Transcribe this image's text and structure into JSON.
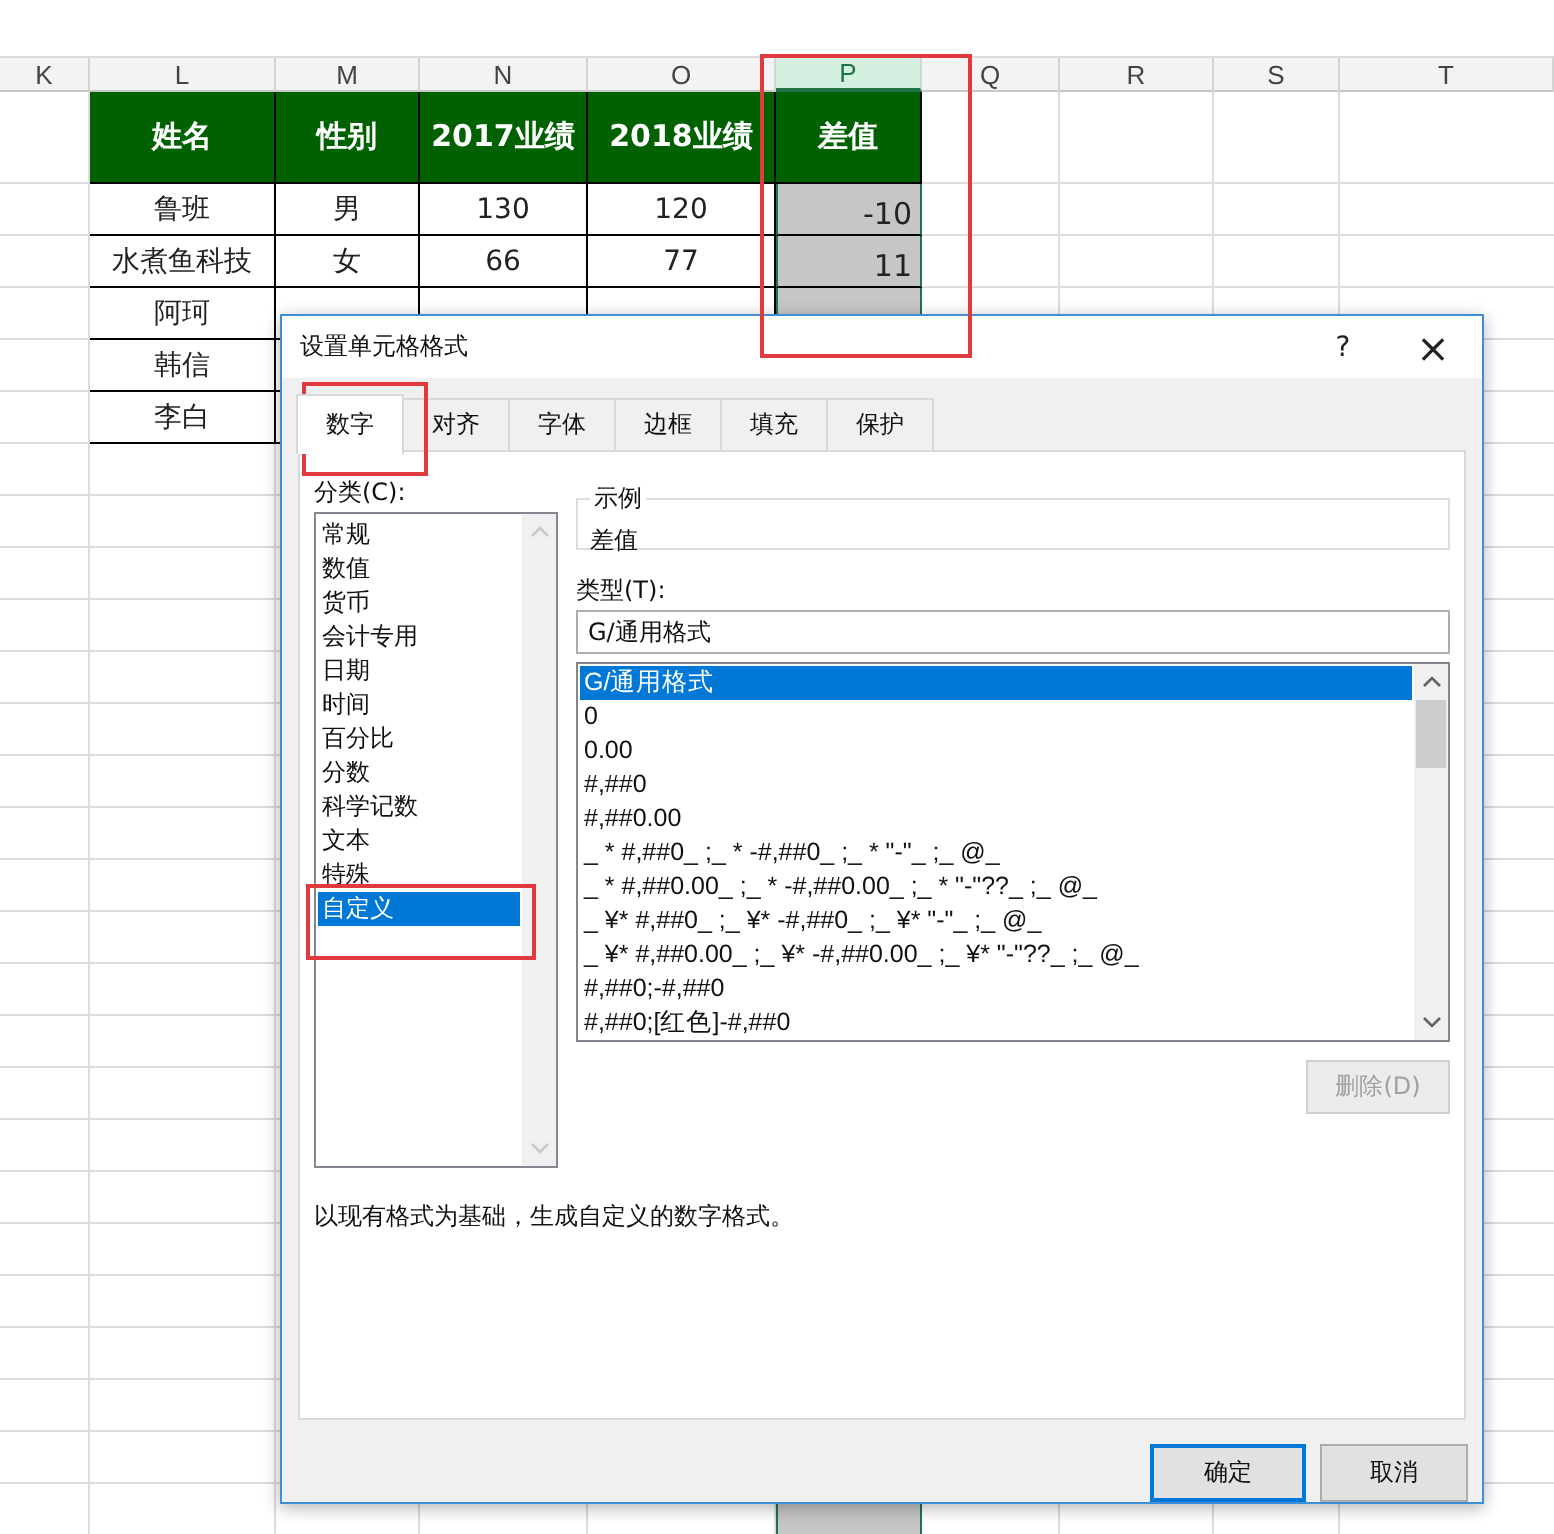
{
  "sheet": {
    "columns": [
      {
        "label": "K",
        "selected": false
      },
      {
        "label": "L",
        "selected": false
      },
      {
        "label": "M",
        "selected": false
      },
      {
        "label": "N",
        "selected": false
      },
      {
        "label": "O",
        "selected": false
      },
      {
        "label": "P",
        "selected": true
      },
      {
        "label": "Q",
        "selected": false
      },
      {
        "label": "R",
        "selected": false
      },
      {
        "label": "S",
        "selected": false
      },
      {
        "label": "T",
        "selected": false
      }
    ],
    "table": {
      "header": [
        "姓名",
        "性别",
        "2017业绩",
        "2018业绩",
        "差值"
      ],
      "rows": [
        [
          "鲁班",
          "男",
          "130",
          "120",
          "-10"
        ],
        [
          "水煮鱼科技",
          "女",
          "66",
          "77",
          "11"
        ],
        [
          "阿珂"
        ],
        [
          "韩信"
        ],
        [
          "李白"
        ]
      ]
    }
  },
  "dialog": {
    "title": "设置单元格格式",
    "help": "?",
    "close": "×",
    "tabs": [
      {
        "label": "数字",
        "selected": true
      },
      {
        "label": "对齐",
        "selected": false
      },
      {
        "label": "字体",
        "selected": false
      },
      {
        "label": "边框",
        "selected": false
      },
      {
        "label": "填充",
        "selected": false
      },
      {
        "label": "保护",
        "selected": false
      }
    ],
    "category_label": "分类(C):",
    "categories": [
      {
        "label": "常规",
        "selected": false
      },
      {
        "label": "数值",
        "selected": false
      },
      {
        "label": "货币",
        "selected": false
      },
      {
        "label": "会计专用",
        "selected": false
      },
      {
        "label": "日期",
        "selected": false
      },
      {
        "label": "时间",
        "selected": false
      },
      {
        "label": "百分比",
        "selected": false
      },
      {
        "label": "分数",
        "selected": false
      },
      {
        "label": "科学记数",
        "selected": false
      },
      {
        "label": "文本",
        "selected": false
      },
      {
        "label": "特殊",
        "selected": false
      },
      {
        "label": "自定义",
        "selected": true
      }
    ],
    "sample": {
      "label": "示例",
      "value": "差值"
    },
    "type_label": "类型(T):",
    "type_value": "G/通用格式",
    "formats": [
      {
        "label": "G/通用格式",
        "selected": true
      },
      {
        "label": "0",
        "selected": false
      },
      {
        "label": "0.00",
        "selected": false
      },
      {
        "label": "#,##0",
        "selected": false
      },
      {
        "label": "#,##0.00",
        "selected": false
      },
      {
        "label": "_ * #,##0_ ;_ * -#,##0_ ;_ * \"-\"_ ;_ @_",
        "selected": false
      },
      {
        "label": "_ * #,##0.00_ ;_ * -#,##0.00_ ;_ * \"-\"??_ ;_ @_",
        "selected": false
      },
      {
        "label": "_ ¥* #,##0_ ;_ ¥* -#,##0_ ;_ ¥* \"-\"_ ;_ @_",
        "selected": false
      },
      {
        "label": "_ ¥* #,##0.00_ ;_ ¥* -#,##0.00_ ;_ ¥* \"-\"??_ ;_ @_",
        "selected": false
      },
      {
        "label": "#,##0;-#,##0",
        "selected": false
      },
      {
        "label": "#,##0;[红色]-#,##0",
        "selected": false
      }
    ],
    "delete_button": {
      "label": "删除(D)",
      "disabled": true
    },
    "description": "以现有格式为基础，生成自定义的数字格式。",
    "buttons": [
      {
        "label": "确定",
        "kind": "primary"
      },
      {
        "label": "取消",
        "kind": "normal"
      }
    ]
  }
}
